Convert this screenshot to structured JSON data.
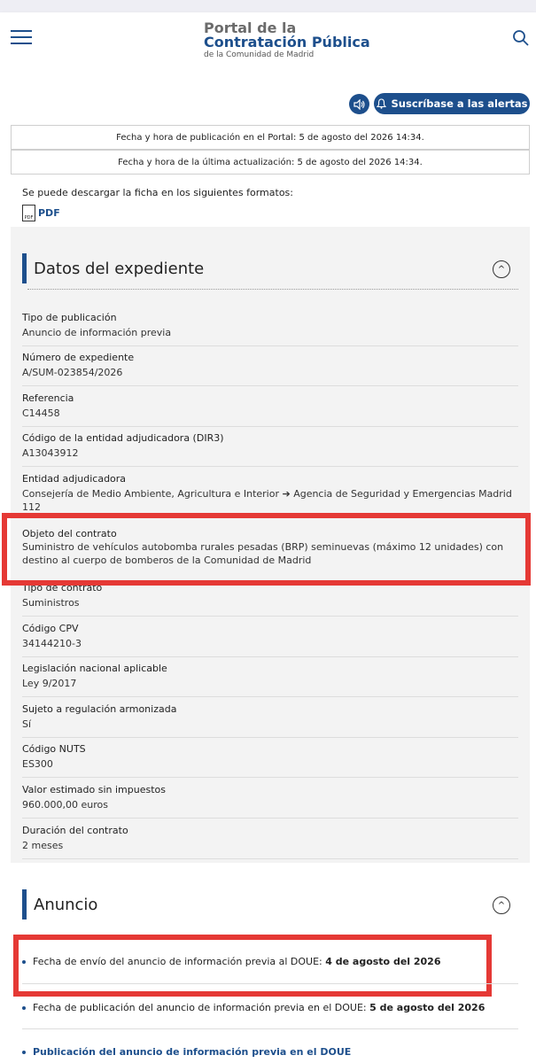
{
  "header": {
    "logo_line1": "Portal de la",
    "logo_line2": "Contratación Pública",
    "logo_line3": "de la Comunidad de Madrid"
  },
  "toolbar": {
    "subscribe_label": "Suscríbase a las alertas"
  },
  "dates": {
    "published": "Fecha y hora de publicación en el Portal: 5 de agosto del 2026 14:34.",
    "updated": "Fecha y hora de la última actualización: 5 de agosto del 2026 14:34."
  },
  "download": {
    "intro": "Se puede descargar la ficha en los siguientes formatos:",
    "pdf_label": "PDF"
  },
  "expediente": {
    "title": "Datos del expediente",
    "fields": [
      {
        "label": "Tipo de publicación",
        "value": "Anuncio de información previa"
      },
      {
        "label": "Número de expediente",
        "value": "A/SUM-023854/2026"
      },
      {
        "label": "Referencia",
        "value": "C14458"
      },
      {
        "label": "Código de la entidad adjudicadora (DIR3)",
        "value": "A13043912"
      },
      {
        "label": "Entidad adjudicadora",
        "value": "Consejería de Medio Ambiente, Agricultura e Interior  ➔ Agencia de Seguridad y Emergencias Madrid 112"
      },
      {
        "label": "Objeto del contrato",
        "value": "Suministro de vehículos autobomba rurales pesadas (BRP) seminuevas (máximo 12 unidades) con destino al cuerpo de bomberos de la Comunidad de Madrid"
      },
      {
        "label": "Tipo de contrato",
        "value": "Suministros"
      },
      {
        "label": "Código CPV",
        "value": "34144210-3"
      },
      {
        "label": "Legislación nacional aplicable",
        "value": "Ley 9/2017"
      },
      {
        "label": "Sujeto a regulación armonizada",
        "value": "Sí"
      },
      {
        "label": "Código NUTS",
        "value": "ES300"
      },
      {
        "label": "Valor estimado sin impuestos",
        "value": "960.000,00 euros"
      },
      {
        "label": "Duración del contrato",
        "value": "2 meses"
      }
    ]
  },
  "anuncio": {
    "title": "Anuncio",
    "items": [
      {
        "text": "Fecha de envío del anuncio de información previa al DOUE:",
        "bold": "4 de agosto del 2026"
      },
      {
        "text": "Fecha de publicación del anuncio de información previa en el DOUE:",
        "bold": "5 de agosto del 2026"
      }
    ],
    "link_label": "Publicación del anuncio de información previa en el DOUE"
  }
}
